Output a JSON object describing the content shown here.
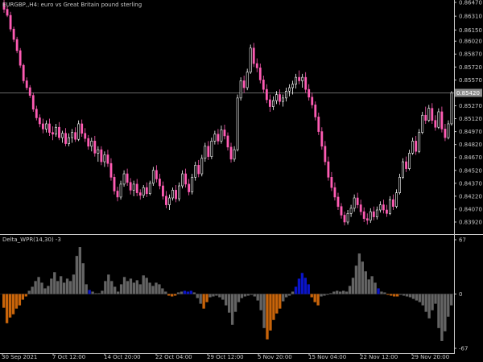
{
  "main_chart": {
    "title": "EURGBP,,H4:  euro vs Great Britain pound sterling",
    "price_axis": [
      "0.86470",
      "0.86310",
      "0.86150",
      "0.86020",
      "0.85870",
      "0.85720",
      "0.85570",
      "0.85420",
      "0.85270",
      "0.85120",
      "0.84970",
      "0.84820",
      "0.84670",
      "0.84520",
      "0.84370",
      "0.84220",
      "0.84070",
      "0.83920"
    ],
    "current_price": "0.85420",
    "bull_color": "#ffffff",
    "bear_color": "#ff5cb4",
    "candles": [
      [
        0.8646,
        0.8652,
        0.8635,
        0.8639
      ],
      [
        0.8639,
        0.8643,
        0.863,
        0.8632
      ],
      [
        0.8632,
        0.8636,
        0.8613,
        0.8616
      ],
      [
        0.8616,
        0.8619,
        0.8601,
        0.8604
      ],
      [
        0.8604,
        0.8607,
        0.8588,
        0.8591
      ],
      [
        0.8591,
        0.8594,
        0.8571,
        0.8574
      ],
      [
        0.8574,
        0.8576,
        0.8553,
        0.8556
      ],
      [
        0.8556,
        0.856,
        0.8545,
        0.8548
      ],
      [
        0.8548,
        0.8551,
        0.8536,
        0.8539
      ],
      [
        0.8539,
        0.8542,
        0.852,
        0.8523
      ],
      [
        0.8523,
        0.8527,
        0.851,
        0.8513
      ],
      [
        0.8513,
        0.8517,
        0.8502,
        0.8506
      ],
      [
        0.8506,
        0.8512,
        0.8495,
        0.85
      ],
      [
        0.85,
        0.851,
        0.8496,
        0.8506
      ],
      [
        0.8506,
        0.8512,
        0.8492,
        0.8496
      ],
      [
        0.8496,
        0.8503,
        0.8487,
        0.8494
      ],
      [
        0.8494,
        0.8506,
        0.8491,
        0.8502
      ],
      [
        0.8502,
        0.8508,
        0.8487,
        0.849
      ],
      [
        0.849,
        0.8498,
        0.8484,
        0.8495
      ],
      [
        0.8495,
        0.8501,
        0.848,
        0.8483
      ],
      [
        0.8483,
        0.8495,
        0.848,
        0.849
      ],
      [
        0.849,
        0.85,
        0.8484,
        0.8496
      ],
      [
        0.8496,
        0.8502,
        0.8485,
        0.8488
      ],
      [
        0.8488,
        0.851,
        0.8486,
        0.8506
      ],
      [
        0.8506,
        0.8511,
        0.8491,
        0.8495
      ],
      [
        0.8495,
        0.8501,
        0.8485,
        0.8489
      ],
      [
        0.8489,
        0.8493,
        0.8476,
        0.848
      ],
      [
        0.848,
        0.849,
        0.8474,
        0.8486
      ],
      [
        0.8486,
        0.8492,
        0.8468,
        0.8472
      ],
      [
        0.8472,
        0.848,
        0.8462,
        0.8476
      ],
      [
        0.8476,
        0.848,
        0.8458,
        0.8462
      ],
      [
        0.8462,
        0.8474,
        0.8456,
        0.847
      ],
      [
        0.847,
        0.8476,
        0.8456,
        0.846
      ],
      [
        0.846,
        0.8466,
        0.844,
        0.8444
      ],
      [
        0.8444,
        0.8448,
        0.8424,
        0.8428
      ],
      [
        0.8428,
        0.8433,
        0.8416,
        0.8421
      ],
      [
        0.8421,
        0.844,
        0.8418,
        0.8436
      ],
      [
        0.8436,
        0.8452,
        0.8433,
        0.8448
      ],
      [
        0.8448,
        0.8454,
        0.8434,
        0.8438
      ],
      [
        0.8438,
        0.8443,
        0.8424,
        0.8429
      ],
      [
        0.8429,
        0.844,
        0.8422,
        0.8436
      ],
      [
        0.8436,
        0.8442,
        0.8422,
        0.8426
      ],
      [
        0.8426,
        0.843,
        0.8418,
        0.8423
      ],
      [
        0.8423,
        0.8435,
        0.842,
        0.8432
      ],
      [
        0.8432,
        0.8438,
        0.8421,
        0.8425
      ],
      [
        0.8425,
        0.844,
        0.8423,
        0.8437
      ],
      [
        0.8437,
        0.8456,
        0.8434,
        0.8452
      ],
      [
        0.8452,
        0.8458,
        0.8438,
        0.8442
      ],
      [
        0.8442,
        0.8448,
        0.843,
        0.8434
      ],
      [
        0.8434,
        0.8439,
        0.8418,
        0.8422
      ],
      [
        0.8422,
        0.8428,
        0.8408,
        0.8412
      ],
      [
        0.8412,
        0.8424,
        0.8406,
        0.842
      ],
      [
        0.842,
        0.8432,
        0.8417,
        0.8429
      ],
      [
        0.8429,
        0.8435,
        0.8415,
        0.8419
      ],
      [
        0.8419,
        0.8438,
        0.8416,
        0.8434
      ],
      [
        0.8434,
        0.8452,
        0.8431,
        0.8448
      ],
      [
        0.8448,
        0.8454,
        0.8432,
        0.8436
      ],
      [
        0.8436,
        0.8442,
        0.8423,
        0.8427
      ],
      [
        0.8427,
        0.8448,
        0.8424,
        0.8444
      ],
      [
        0.8444,
        0.8462,
        0.844,
        0.8458
      ],
      [
        0.8458,
        0.8464,
        0.8444,
        0.8448
      ],
      [
        0.8448,
        0.847,
        0.8445,
        0.8466
      ],
      [
        0.8466,
        0.8484,
        0.8462,
        0.848
      ],
      [
        0.848,
        0.8486,
        0.8464,
        0.8468
      ],
      [
        0.8468,
        0.849,
        0.8465,
        0.8486
      ],
      [
        0.8486,
        0.8498,
        0.8482,
        0.8494
      ],
      [
        0.8494,
        0.85,
        0.8482,
        0.8486
      ],
      [
        0.8486,
        0.8504,
        0.8483,
        0.8499
      ],
      [
        0.8499,
        0.8505,
        0.8488,
        0.8492
      ],
      [
        0.8492,
        0.8496,
        0.8475,
        0.8479
      ],
      [
        0.8479,
        0.8484,
        0.8461,
        0.8465
      ],
      [
        0.8465,
        0.848,
        0.8462,
        0.8476
      ],
      [
        0.8476,
        0.854,
        0.8474,
        0.8536
      ],
      [
        0.8536,
        0.856,
        0.8533,
        0.8556
      ],
      [
        0.8556,
        0.8562,
        0.8542,
        0.8548
      ],
      [
        0.8548,
        0.857,
        0.8545,
        0.8566
      ],
      [
        0.8566,
        0.8598,
        0.8564,
        0.8594
      ],
      [
        0.8594,
        0.86,
        0.8572,
        0.8576
      ],
      [
        0.8576,
        0.8582,
        0.8566,
        0.8571
      ],
      [
        0.8571,
        0.8576,
        0.8553,
        0.8557
      ],
      [
        0.8557,
        0.8562,
        0.8542,
        0.8546
      ],
      [
        0.8546,
        0.8552,
        0.853,
        0.8534
      ],
      [
        0.8534,
        0.854,
        0.852,
        0.8526
      ],
      [
        0.8526,
        0.8538,
        0.8522,
        0.8533
      ],
      [
        0.8533,
        0.8544,
        0.8529,
        0.854
      ],
      [
        0.854,
        0.8546,
        0.8528,
        0.8532
      ],
      [
        0.8532,
        0.854,
        0.8526,
        0.8536
      ],
      [
        0.8536,
        0.8548,
        0.8532,
        0.8544
      ],
      [
        0.8544,
        0.8552,
        0.8538,
        0.8548
      ],
      [
        0.8548,
        0.8556,
        0.854,
        0.8552
      ],
      [
        0.8552,
        0.8564,
        0.8547,
        0.856
      ],
      [
        0.856,
        0.8568,
        0.8552,
        0.8556
      ],
      [
        0.8556,
        0.8564,
        0.8548,
        0.856
      ],
      [
        0.856,
        0.8566,
        0.8542,
        0.8546
      ],
      [
        0.8546,
        0.8552,
        0.8533,
        0.8537
      ],
      [
        0.8537,
        0.8542,
        0.8524,
        0.8528
      ],
      [
        0.8528,
        0.8532,
        0.851,
        0.8514
      ],
      [
        0.8514,
        0.8519,
        0.8493,
        0.8497
      ],
      [
        0.8497,
        0.8502,
        0.8476,
        0.848
      ],
      [
        0.848,
        0.8486,
        0.8458,
        0.8462
      ],
      [
        0.8462,
        0.8468,
        0.844,
        0.8444
      ],
      [
        0.8444,
        0.845,
        0.8428,
        0.8432
      ],
      [
        0.8432,
        0.8438,
        0.8417,
        0.8421
      ],
      [
        0.8421,
        0.8426,
        0.8406,
        0.841
      ],
      [
        0.841,
        0.8414,
        0.8396,
        0.84
      ],
      [
        0.84,
        0.8404,
        0.8388,
        0.8392
      ],
      [
        0.8392,
        0.8406,
        0.8389,
        0.8402
      ],
      [
        0.8402,
        0.8412,
        0.8398,
        0.8408
      ],
      [
        0.8408,
        0.8424,
        0.8404,
        0.842
      ],
      [
        0.842,
        0.8426,
        0.8408,
        0.8412
      ],
      [
        0.8412,
        0.8418,
        0.84,
        0.8404
      ],
      [
        0.8404,
        0.8409,
        0.8392,
        0.8396
      ],
      [
        0.8396,
        0.8402,
        0.8389,
        0.8394
      ],
      [
        0.8394,
        0.8408,
        0.8391,
        0.8404
      ],
      [
        0.8404,
        0.841,
        0.8394,
        0.8398
      ],
      [
        0.8398,
        0.841,
        0.8395,
        0.8406
      ],
      [
        0.8406,
        0.8416,
        0.8403,
        0.8412
      ],
      [
        0.8412,
        0.8418,
        0.8402,
        0.8406
      ],
      [
        0.8406,
        0.8412,
        0.8398,
        0.8402
      ],
      [
        0.8402,
        0.8422,
        0.84,
        0.8418
      ],
      [
        0.8418,
        0.8424,
        0.8406,
        0.841
      ],
      [
        0.841,
        0.843,
        0.8408,
        0.8426
      ],
      [
        0.8426,
        0.8448,
        0.8424,
        0.8444
      ],
      [
        0.8444,
        0.8466,
        0.8442,
        0.8462
      ],
      [
        0.8462,
        0.8468,
        0.845,
        0.8454
      ],
      [
        0.8454,
        0.8476,
        0.8452,
        0.8472
      ],
      [
        0.8472,
        0.849,
        0.847,
        0.8486
      ],
      [
        0.8486,
        0.8492,
        0.847,
        0.8474
      ],
      [
        0.8474,
        0.85,
        0.8472,
        0.8496
      ],
      [
        0.8496,
        0.852,
        0.8494,
        0.8516
      ],
      [
        0.8516,
        0.8526,
        0.8506,
        0.851
      ],
      [
        0.851,
        0.8528,
        0.8508,
        0.8524
      ],
      [
        0.8524,
        0.853,
        0.8506,
        0.851
      ],
      [
        0.851,
        0.8516,
        0.8498,
        0.8502
      ],
      [
        0.8502,
        0.8524,
        0.85,
        0.852
      ],
      [
        0.852,
        0.8526,
        0.8496,
        0.85
      ],
      [
        0.85,
        0.8506,
        0.8486,
        0.849
      ],
      [
        0.849,
        0.851,
        0.8488,
        0.8506
      ],
      [
        0.8506,
        0.8544,
        0.8504,
        0.8542
      ]
    ]
  },
  "indicator": {
    "title": "Delta_WPR(14,30) -3",
    "axis": [
      "67",
      "0",
      "-67"
    ],
    "colors": {
      "neutral": "#646464",
      "positive": "#0a14c8",
      "negative": "#c8640a"
    },
    "bars": [
      [
        -17,
        "negative"
      ],
      [
        -36,
        "negative"
      ],
      [
        -29,
        "negative"
      ],
      [
        -25,
        "negative"
      ],
      [
        -18,
        "negative"
      ],
      [
        -14,
        "negative"
      ],
      [
        -7,
        "negative"
      ],
      [
        -3,
        "negative"
      ],
      [
        4,
        "neutral"
      ],
      [
        9,
        "neutral"
      ],
      [
        16,
        "neutral"
      ],
      [
        21,
        "neutral"
      ],
      [
        14,
        "neutral"
      ],
      [
        7,
        "neutral"
      ],
      [
        10,
        "neutral"
      ],
      [
        19,
        "neutral"
      ],
      [
        27,
        "neutral"
      ],
      [
        16,
        "neutral"
      ],
      [
        22,
        "neutral"
      ],
      [
        14,
        "neutral"
      ],
      [
        19,
        "neutral"
      ],
      [
        16,
        "neutral"
      ],
      [
        24,
        "neutral"
      ],
      [
        47,
        "neutral"
      ],
      [
        58,
        "neutral"
      ],
      [
        38,
        "neutral"
      ],
      [
        12,
        "neutral"
      ],
      [
        5,
        "positive"
      ],
      [
        3,
        "neutral"
      ],
      [
        1,
        "neutral"
      ],
      [
        1,
        "neutral"
      ],
      [
        4,
        "neutral"
      ],
      [
        16,
        "neutral"
      ],
      [
        24,
        "neutral"
      ],
      [
        16,
        "neutral"
      ],
      [
        9,
        "neutral"
      ],
      [
        3,
        "neutral"
      ],
      [
        12,
        "neutral"
      ],
      [
        21,
        "neutral"
      ],
      [
        16,
        "neutral"
      ],
      [
        19,
        "neutral"
      ],
      [
        14,
        "neutral"
      ],
      [
        17,
        "neutral"
      ],
      [
        12,
        "neutral"
      ],
      [
        23,
        "neutral"
      ],
      [
        20,
        "neutral"
      ],
      [
        14,
        "neutral"
      ],
      [
        10,
        "neutral"
      ],
      [
        14,
        "neutral"
      ],
      [
        12,
        "neutral"
      ],
      [
        7,
        "neutral"
      ],
      [
        3,
        "neutral"
      ],
      [
        -2,
        "negative"
      ],
      [
        -3,
        "negative"
      ],
      [
        -2,
        "negative"
      ],
      [
        2,
        "neutral"
      ],
      [
        3,
        "neutral"
      ],
      [
        4,
        "positive"
      ],
      [
        3,
        "positive"
      ],
      [
        4,
        "positive"
      ],
      [
        2,
        "neutral"
      ],
      [
        -5,
        "neutral"
      ],
      [
        -12,
        "neutral"
      ],
      [
        -18,
        "negative"
      ],
      [
        -10,
        "negative"
      ],
      [
        -4,
        "neutral"
      ],
      [
        -3,
        "neutral"
      ],
      [
        -2,
        "neutral"
      ],
      [
        -4,
        "neutral"
      ],
      [
        -7,
        "neutral"
      ],
      [
        -14,
        "neutral"
      ],
      [
        -23,
        "neutral"
      ],
      [
        -38,
        "neutral"
      ],
      [
        -22,
        "neutral"
      ],
      [
        -10,
        "neutral"
      ],
      [
        -5,
        "neutral"
      ],
      [
        -3,
        "neutral"
      ],
      [
        -2,
        "neutral"
      ],
      [
        -1,
        "neutral"
      ],
      [
        -3,
        "neutral"
      ],
      [
        -8,
        "neutral"
      ],
      [
        -20,
        "neutral"
      ],
      [
        -42,
        "neutral"
      ],
      [
        -56,
        "negative"
      ],
      [
        -45,
        "negative"
      ],
      [
        -32,
        "negative"
      ],
      [
        -24,
        "negative"
      ],
      [
        -18,
        "negative"
      ],
      [
        -9,
        "neutral"
      ],
      [
        -4,
        "neutral"
      ],
      [
        -2,
        "neutral"
      ],
      [
        3,
        "neutral"
      ],
      [
        9,
        "positive"
      ],
      [
        19,
        "positive"
      ],
      [
        26,
        "positive"
      ],
      [
        20,
        "positive"
      ],
      [
        12,
        "positive"
      ],
      [
        -4,
        "negative"
      ],
      [
        -10,
        "negative"
      ],
      [
        -14,
        "negative"
      ],
      [
        -3,
        "neutral"
      ],
      [
        -2,
        "neutral"
      ],
      [
        -1,
        "neutral"
      ],
      [
        1,
        "neutral"
      ],
      [
        3,
        "neutral"
      ],
      [
        4,
        "neutral"
      ],
      [
        3,
        "neutral"
      ],
      [
        4,
        "neutral"
      ],
      [
        3,
        "neutral"
      ],
      [
        10,
        "neutral"
      ],
      [
        20,
        "neutral"
      ],
      [
        35,
        "neutral"
      ],
      [
        50,
        "neutral"
      ],
      [
        40,
        "neutral"
      ],
      [
        28,
        "neutral"
      ],
      [
        18,
        "neutral"
      ],
      [
        22,
        "neutral"
      ],
      [
        14,
        "neutral"
      ],
      [
        7,
        "positive"
      ],
      [
        3,
        "neutral"
      ],
      [
        2,
        "neutral"
      ],
      [
        -1,
        "negative"
      ],
      [
        -2,
        "negative"
      ],
      [
        -3,
        "negative"
      ],
      [
        -3,
        "negative"
      ],
      [
        -1,
        "neutral"
      ],
      [
        -2,
        "neutral"
      ],
      [
        -3,
        "neutral"
      ],
      [
        -4,
        "neutral"
      ],
      [
        -6,
        "neutral"
      ],
      [
        -8,
        "neutral"
      ],
      [
        -10,
        "neutral"
      ],
      [
        -14,
        "neutral"
      ],
      [
        -22,
        "neutral"
      ],
      [
        -30,
        "neutral"
      ],
      [
        -20,
        "neutral"
      ],
      [
        -12,
        "neutral"
      ],
      [
        -42,
        "neutral"
      ],
      [
        -58,
        "neutral"
      ],
      [
        -46,
        "neutral"
      ],
      [
        -28,
        "neutral"
      ],
      [
        -14,
        "neutral"
      ]
    ]
  },
  "time_axis": [
    "30 Sep 2021",
    "7 Oct 12:00",
    "14 Oct 20:00",
    "22 Oct 04:00",
    "29 Oct 12:00",
    "5 Nov 20:00",
    "15 Nov 04:00",
    "22 Nov 12:00",
    "29 Nov 20:00"
  ]
}
